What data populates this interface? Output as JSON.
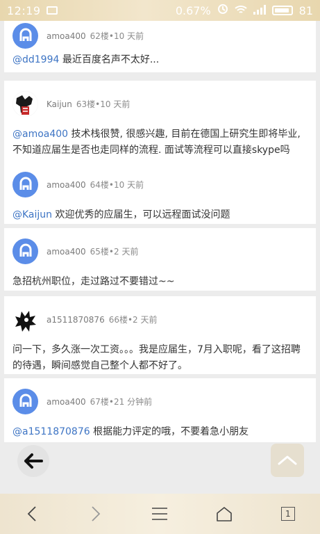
{
  "status": {
    "time": "12:19",
    "data_rate": "0.67%",
    "battery": "81"
  },
  "posts": [
    {
      "user": "amoa400",
      "floor": "62楼•10 天前",
      "mention": "@dd1994",
      "text": " 最近百度名声不太好..."
    },
    {
      "user": "Kaijun",
      "floor": "63楼•10 天前",
      "mention": "@amoa400",
      "text": " 技术栈很赞, 很感兴趣, 目前在德国上研究生即将毕业, 不知道应届生是否也走同样的流程. 面试等流程可以直接skype吗"
    },
    {
      "user": "amoa400",
      "floor": "64楼•10 天前",
      "mention": "@Kaijun",
      "text": " 欢迎优秀的应届生，可以远程面试没问题"
    },
    {
      "user": "amoa400",
      "floor": "65楼•2 天前",
      "mention": "",
      "text": "急招杭州职位，走过路过不要错过~~"
    },
    {
      "user": "a1511870876",
      "floor": "66楼•2 天前",
      "mention": "",
      "text": "问一下，多久涨一次工资。。。我是应届生，7月入职呢，看了这招聘的待遇，瞬间感觉自己整个人都不好了。"
    },
    {
      "user": "amoa400",
      "floor": "67楼•21 分钟前",
      "mention": "@a1511870876",
      "text": " 根据能力评定的哦，不要着急小朋友"
    }
  ],
  "tab_count": "1",
  "colors": {
    "accent_link": "#3d74c4",
    "avatar_blue": "#5b8de8",
    "statusbar_bg": "#e8d7ae"
  }
}
